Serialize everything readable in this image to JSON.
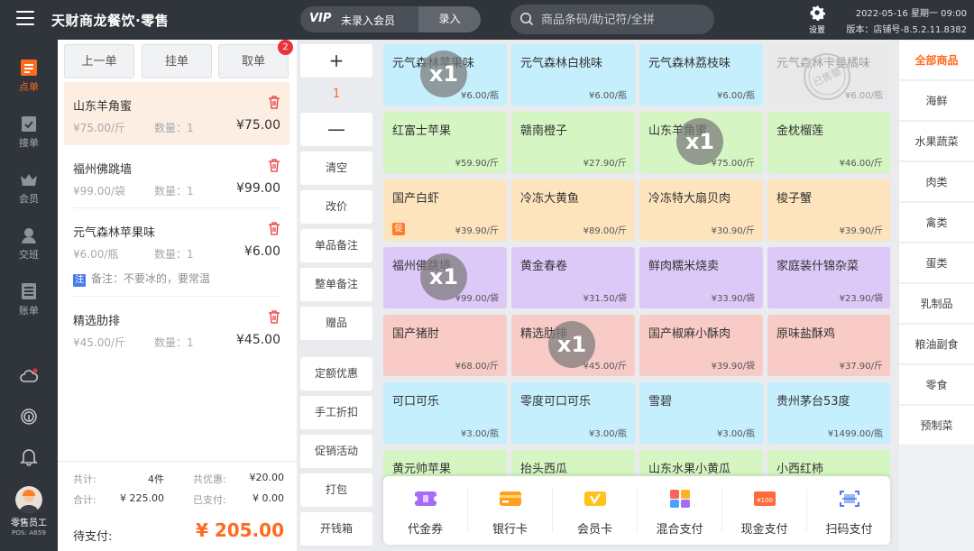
{
  "header": {
    "title": "天财商龙餐饮·零售",
    "vip_logo": "VIP",
    "member_status": "未录入会员",
    "enter_label": "录入",
    "search_placeholder": "商品条码/助记符/全拼",
    "settings_label": "设置",
    "datetime": "2022-05-16 星期一 09:00",
    "version": "版本：店铺号-8.5.2.11.8382"
  },
  "nav": {
    "items": [
      {
        "label": "点单",
        "icon": "order-icon",
        "active": true
      },
      {
        "label": "接单",
        "icon": "receive-order-icon"
      },
      {
        "label": "会员",
        "icon": "member-crown-icon"
      },
      {
        "label": "交班",
        "icon": "shift-handover-icon"
      },
      {
        "label": "账单",
        "icon": "bill-icon"
      }
    ],
    "icons": [
      "cloud-sync-icon",
      "fingerprint-icon",
      "bell-icon"
    ],
    "staff_name": "零售员工",
    "staff_pos": "POS: A659"
  },
  "order": {
    "actions": [
      {
        "label": "上一单"
      },
      {
        "label": "挂单"
      },
      {
        "label": "取单",
        "badge": "2"
      }
    ],
    "items": [
      {
        "name": "山东羊角蜜",
        "unit_price": "¥75.00/斤",
        "qty": "数量：1",
        "subtotal": "¥75.00",
        "selected": true,
        "note": ""
      },
      {
        "name": "福州佛跳墙",
        "unit_price": "¥99.00/袋",
        "qty": "数量：1",
        "subtotal": "¥99.00",
        "note": ""
      },
      {
        "name": "元气森林苹果味",
        "unit_price": "¥6.00/瓶",
        "qty": "数量：1",
        "subtotal": "¥6.00",
        "note_tag": "注",
        "note": "备注：不要冰的，要常温"
      },
      {
        "name": "精选肋排",
        "unit_price": "¥45.00/斤",
        "qty": "数量：1",
        "subtotal": "¥45.00",
        "note": ""
      }
    ],
    "summary": {
      "total_label": "共计:",
      "total_value": "4件",
      "discount_label": "共优惠:",
      "discount_value": "¥20.00",
      "amount_label": "合计:",
      "amount_value": "¥ 225.00",
      "paid_label": "已支付:",
      "paid_value": "¥ 0.00",
      "due_label": "待支付:",
      "due_value": "¥ 205.00"
    }
  },
  "toolbar": {
    "plus": "+",
    "qty": "1",
    "minus": "—",
    "buttons": [
      "清空",
      "改价",
      "单品备注",
      "整单备注",
      "赠品",
      "定额优惠",
      "手工折扣",
      "促销活动",
      "打包",
      "开钱箱"
    ]
  },
  "colors": {
    "accent": "#ff6a1f",
    "card_blue": "#c5effc",
    "card_green": "#d5f5c2",
    "card_orange": "#fde4bd",
    "card_purple": "#ddc9f8",
    "card_red": "#f9cbc6",
    "card_gray": "#e9e9e9"
  },
  "products": [
    {
      "name": "元气森林苹果味",
      "price": "¥6.00/瓶",
      "color": "blue",
      "count": "x1"
    },
    {
      "name": "元气森林白桃味",
      "price": "¥6.00/瓶",
      "color": "blue"
    },
    {
      "name": "元气森林荔枝味",
      "price": "¥6.00/瓶",
      "color": "blue"
    },
    {
      "name": "元气森林卡曼橘味",
      "price": "¥6.00/瓶",
      "color": "gray",
      "soldout": "已售罄"
    },
    {
      "name": "红富士苹果",
      "price": "¥59.90/斤",
      "color": "green"
    },
    {
      "name": "赣南橙子",
      "price": "¥27.90/斤",
      "color": "green"
    },
    {
      "name": "山东羊角蜜",
      "price": "¥75.00/斤",
      "color": "green",
      "count": "x1"
    },
    {
      "name": "金枕榴莲",
      "price": "¥46.00/斤",
      "color": "green"
    },
    {
      "name": "国产白虾",
      "price": "¥39.90/斤",
      "color": "orange",
      "promo": "促"
    },
    {
      "name": "冷冻大黄鱼",
      "price": "¥89.00/斤",
      "color": "orange"
    },
    {
      "name": "冷冻特大扇贝肉",
      "price": "¥30.90/斤",
      "color": "orange"
    },
    {
      "name": "梭子蟹",
      "price": "¥39.90/斤",
      "color": "orange"
    },
    {
      "name": "福州佛跳墙",
      "price": "¥99.00/袋",
      "color": "purple",
      "count": "x1"
    },
    {
      "name": "黄金春卷",
      "price": "¥31.50/袋",
      "color": "purple"
    },
    {
      "name": "鲜肉糯米烧卖",
      "price": "¥33.90/袋",
      "color": "purple"
    },
    {
      "name": "家庭装什锦杂菜",
      "price": "¥23.90/袋",
      "color": "purple"
    },
    {
      "name": "国产猪肘",
      "price": "¥68.00/斤",
      "color": "red"
    },
    {
      "name": "精选肋排",
      "price": "¥45.00/斤",
      "color": "red",
      "count": "x1"
    },
    {
      "name": "国产椒麻小酥肉",
      "price": "¥39.90/袋",
      "color": "red"
    },
    {
      "name": "原味盐酥鸡",
      "price": "¥37.90/斤",
      "color": "red"
    },
    {
      "name": "可口可乐",
      "price": "¥3.00/瓶",
      "color": "blue"
    },
    {
      "name": "零度可口可乐",
      "price": "¥3.00/瓶",
      "color": "blue"
    },
    {
      "name": "雪碧",
      "price": "¥3.00/瓶",
      "color": "blue"
    },
    {
      "name": "贵州茅台53度",
      "price": "¥1499.00/瓶",
      "color": "blue"
    },
    {
      "name": "黄元帅苹果",
      "price": "",
      "color": "green"
    },
    {
      "name": "抬头西瓜",
      "price": "",
      "color": "green"
    },
    {
      "name": "山东水果小黄瓜",
      "price": "",
      "color": "green"
    },
    {
      "name": "小西红柿",
      "price": "",
      "color": "green"
    }
  ],
  "payments": [
    {
      "label": "代金券",
      "icon": "voucher-icon"
    },
    {
      "label": "银行卡",
      "icon": "bank-card-icon"
    },
    {
      "label": "会员卡",
      "icon": "member-card-icon"
    },
    {
      "label": "混合支付",
      "icon": "mixed-pay-icon"
    },
    {
      "label": "现金支付",
      "icon": "cash-pay-icon",
      "icon_text": "¥100"
    },
    {
      "label": "扫码支付",
      "icon": "scan-pay-icon"
    }
  ],
  "categories": [
    {
      "label": "全部商品",
      "active": true
    },
    {
      "label": "海鲜"
    },
    {
      "label": "水果蔬菜"
    },
    {
      "label": "肉类"
    },
    {
      "label": "禽类"
    },
    {
      "label": "蛋类"
    },
    {
      "label": "乳制品"
    },
    {
      "label": "粮油副食"
    },
    {
      "label": "零食"
    },
    {
      "label": "预制菜"
    }
  ]
}
